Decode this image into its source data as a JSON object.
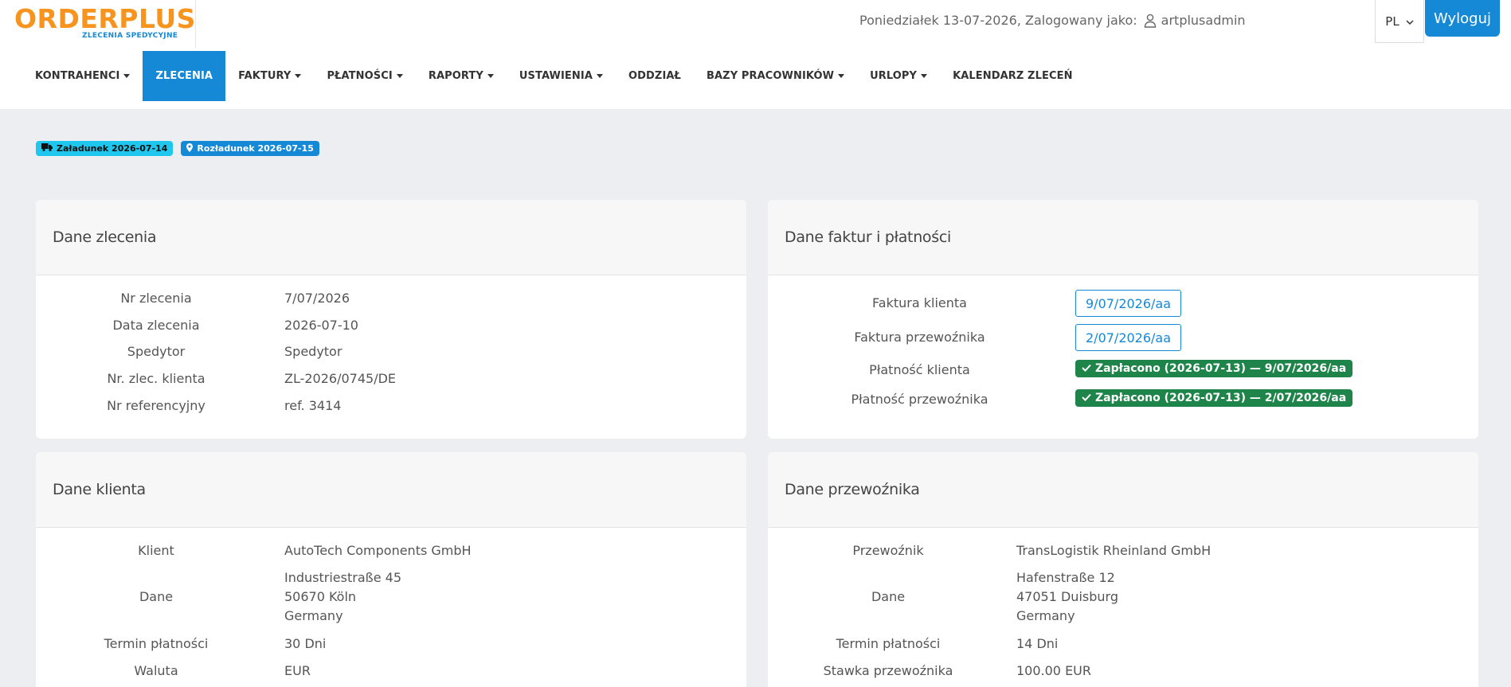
{
  "logo": {
    "main": "ORDERPLUS",
    "sub": "ZLECENIA SPEDYCYJNE"
  },
  "topbar": {
    "info": "Poniedziałek 13-07-2026, Zalogowany jako:",
    "username": "artplusadmin",
    "lang": "PL",
    "logout": "Wyloguj"
  },
  "nav": [
    {
      "label": "KONTRAHENCI",
      "dropdown": true
    },
    {
      "label": "ZLECENIA",
      "dropdown": false,
      "active": true
    },
    {
      "label": "FAKTURY",
      "dropdown": true
    },
    {
      "label": "PŁATNOŚCI",
      "dropdown": true
    },
    {
      "label": "RAPORTY",
      "dropdown": true
    },
    {
      "label": "USTAWIENIA",
      "dropdown": true
    },
    {
      "label": "ODDZIAŁ",
      "dropdown": false
    },
    {
      "label": "BAZY PRACOWNIKÓW",
      "dropdown": true
    },
    {
      "label": "URLOPY",
      "dropdown": true
    },
    {
      "label": "KALENDARZ ZLECEŃ",
      "dropdown": false
    }
  ],
  "badges": {
    "load": "Załadunek 2026-07-14",
    "unload": "Rozładunek 2026-07-15"
  },
  "order": {
    "title": "Dane zlecenia",
    "rows": [
      {
        "label": "Nr zlecenia",
        "value": "7/07/2026"
      },
      {
        "label": "Data zlecenia",
        "value": "2026-07-10"
      },
      {
        "label": "Spedytor",
        "value": "Spedytor"
      },
      {
        "label": "Nr. zlec. klienta",
        "value": "ZL-2026/0745/DE"
      },
      {
        "label": "Nr referencyjny",
        "value": "ref. 3414"
      }
    ]
  },
  "invoices": {
    "title": "Dane faktur i płatności",
    "client_invoice_label": "Faktura klienta",
    "client_invoice": "9/07/2026/aa",
    "carrier_invoice_label": "Faktura przewoźnika",
    "carrier_invoice": "2/07/2026/aa",
    "client_payment_label": "Płatność klienta",
    "client_payment": "Zapłacono (2026-07-13) — 9/07/2026/aa",
    "carrier_payment_label": "Płatność przewoźnika",
    "carrier_payment": "Zapłacono (2026-07-13) — 2/07/2026/aa"
  },
  "client": {
    "title": "Dane klienta",
    "name_label": "Klient",
    "name": "AutoTech Components GmbH",
    "data_label": "Dane",
    "addr1": "Industriestraße 45",
    "addr2": "50670 Köln",
    "addr3": "Germany",
    "term_label": "Termin płatności",
    "term": "30 Dni",
    "currency_label": "Waluta",
    "currency": "EUR"
  },
  "carrier": {
    "title": "Dane przewoźnika",
    "name_label": "Przewoźnik",
    "name": "TransLogistik Rheinland GmbH",
    "data_label": "Dane",
    "addr1": "Hafenstraße 12",
    "addr2": "47051 Duisburg",
    "addr3": "Germany",
    "term_label": "Termin płatności",
    "term": "14 Dni",
    "rate_label": "Stawka przewoźnika",
    "rate": "100.00 EUR"
  },
  "colors": {
    "primary": "#1589d6",
    "brand_orange": "#f7941d",
    "success": "#1e8449",
    "badge_cyan": "#1fc6ee"
  }
}
